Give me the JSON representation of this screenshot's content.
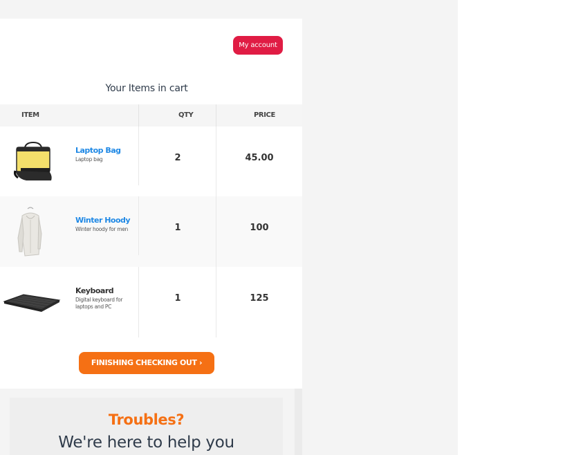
{
  "header": {
    "account_button": "My account"
  },
  "cart": {
    "title": "Your Items in cart",
    "columns": {
      "item": "ITEM",
      "qty": "QTY",
      "price": "PRICE"
    },
    "items": [
      {
        "name": "Laptop Bag",
        "description": "Laptop bag",
        "qty": "2",
        "price": "45.00",
        "icon": "laptop-bag-image"
      },
      {
        "name": "Winter Hoody",
        "description": "Winter hoody for men",
        "qty": "1",
        "price": "100",
        "icon": "hoody-image"
      },
      {
        "name": "Keyboard",
        "description": "Digital keyboard for laptops and PC",
        "qty": "1",
        "price": "125",
        "icon": "keyboard-image"
      }
    ]
  },
  "checkout": {
    "label": "FINISHING CHECKING OUT ›"
  },
  "help": {
    "title": "Troubles?",
    "subtitle": "We're here to help you"
  },
  "colors": {
    "account_red": "#e01c44",
    "link_blue": "#1e88e5",
    "orange": "#f57014"
  }
}
